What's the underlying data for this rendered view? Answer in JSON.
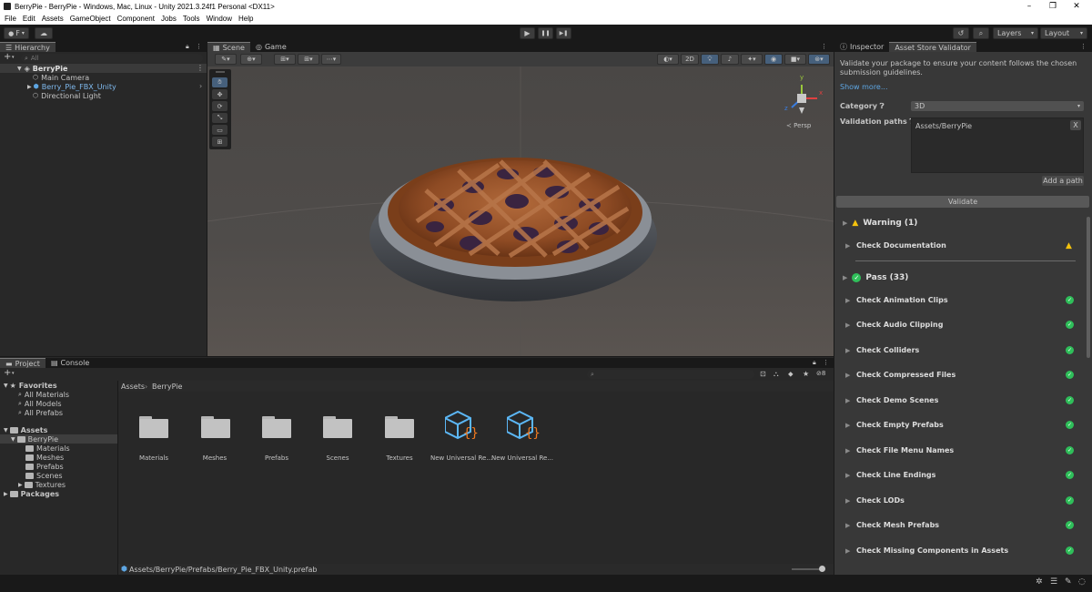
{
  "window": {
    "title": "BerryPie - BerryPie - Windows, Mac, Linux - Unity 2021.3.24f1 Personal <DX11>",
    "controls": [
      "–",
      "❐",
      "✕"
    ]
  },
  "menu": [
    "File",
    "Edit",
    "Assets",
    "GameObject",
    "Component",
    "Jobs",
    "Tools",
    "Window",
    "Help"
  ],
  "toolbar": {
    "account_label": "F",
    "layers_label": "Layers",
    "layout_label": "Layout",
    "play": "▶",
    "pause": "❚❚",
    "step": "▶❚"
  },
  "hierarchy": {
    "tab": "Hierarchy",
    "search_placeholder": "All",
    "scene": "BerryPie",
    "items": [
      "Main Camera",
      "Berry_Pie_FBX_Unity",
      "Directional Light"
    ]
  },
  "scene_view": {
    "tabs": [
      "Scene",
      "Game"
    ],
    "mode_2d": "2D",
    "gizmo_labels": {
      "y": "y",
      "x": "x",
      "z": "z"
    },
    "persp_label": "Persp"
  },
  "project": {
    "tabs": [
      "Project",
      "Console"
    ],
    "favorites_label": "Favorites",
    "favorites": [
      "All Materials",
      "All Models",
      "All Prefabs"
    ],
    "assets_label": "Assets",
    "tree": [
      "BerryPie",
      "Materials",
      "Meshes",
      "Prefabs",
      "Scenes",
      "Textures"
    ],
    "packages_label": "Packages",
    "breadcrumb": [
      "Assets",
      "BerryPie"
    ],
    "grid": [
      {
        "name": "Materials",
        "kind": "folder"
      },
      {
        "name": "Meshes",
        "kind": "folder"
      },
      {
        "name": "Prefabs",
        "kind": "folder"
      },
      {
        "name": "Scenes",
        "kind": "folder"
      },
      {
        "name": "Textures",
        "kind": "folder"
      },
      {
        "name": "New Universal Re...",
        "kind": "asset"
      },
      {
        "name": "New Universal Re...",
        "kind": "asset"
      }
    ],
    "hidden_count": "8",
    "status_path": "Assets/BerryPie/Prefabs/Berry_Pie_FBX_Unity.prefab"
  },
  "inspector": {
    "tabs": [
      "Inspector",
      "Asset Store Validator"
    ],
    "description": "Validate your package to ensure your content follows the chosen submission guidelines.",
    "show_more": "Show more...",
    "category_label": "Category",
    "category_value": "3D",
    "validation_paths_label": "Validation paths",
    "validation_path": "Assets/BerryPie",
    "remove_path": "X",
    "add_path": "Add a path",
    "validate": "Validate",
    "warning_header": "Warning (1)",
    "warning_checks": [
      "Check Documentation"
    ],
    "pass_header": "Pass (33)",
    "pass_checks": [
      "Check Animation Clips",
      "Check Audio Clipping",
      "Check Colliders",
      "Check Compressed Files",
      "Check Demo Scenes",
      "Check Empty Prefabs",
      "Check File Menu Names",
      "Check Line Endings",
      "Check LODs",
      "Check Mesh Prefabs",
      "Check Missing Components in Assets"
    ]
  },
  "colors": {
    "accent_blue": "#4c7fb8",
    "selection": "#2c5d87",
    "pass_green": "#2fbf5a",
    "warning_yellow": "#f4c20d"
  }
}
